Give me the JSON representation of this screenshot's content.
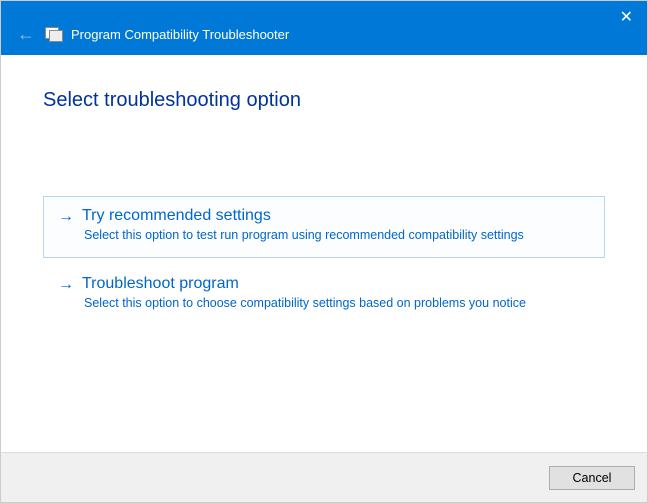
{
  "window": {
    "title": "Program Compatibility Troubleshooter"
  },
  "content": {
    "heading": "Select troubleshooting option"
  },
  "options": [
    {
      "title": "Try recommended settings",
      "description": "Select this option to test run program using recommended compatibility settings"
    },
    {
      "title": "Troubleshoot program",
      "description": "Select this option to choose compatibility settings based on problems you notice"
    }
  ],
  "footer": {
    "cancel": "Cancel"
  }
}
